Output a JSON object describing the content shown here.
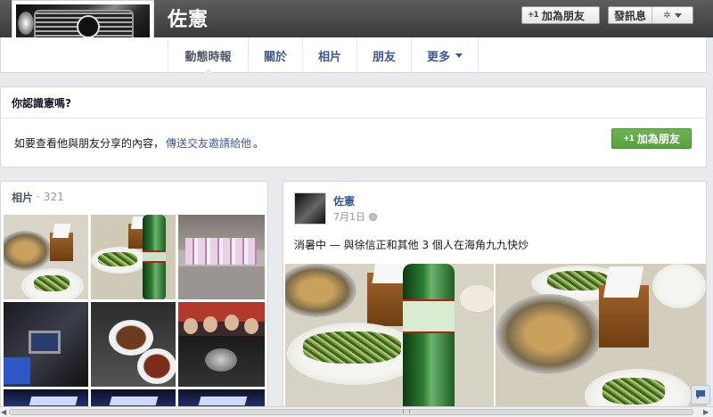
{
  "profile": {
    "name": "佐憲"
  },
  "header_actions": {
    "add_friend_label": "加為朋友",
    "add_friend_glyph": "+1",
    "message_label": "發訊息",
    "settings_glyph": "✲"
  },
  "tabs": [
    {
      "label": "動態時報",
      "active": true
    },
    {
      "label": "關於",
      "active": false
    },
    {
      "label": "相片",
      "active": false
    },
    {
      "label": "朋友",
      "active": false
    },
    {
      "label": "更多",
      "active": false
    }
  ],
  "know_box": {
    "title": "你認識憲嗎?",
    "body_prefix": "如要查看他與朋友分享的內容，",
    "body_link": "傳送交友邀請給他",
    "body_suffix": "。",
    "button_label": "加為朋友",
    "button_glyph": "+1"
  },
  "photos_panel": {
    "title": "相片",
    "separator": "·",
    "count": "321"
  },
  "post": {
    "author": "佐憲",
    "date": "7月1日",
    "text_prefix": "消暑中 — 與",
    "tagged": "徐信正",
    "text_mid": "和",
    "others": "其他 3 個人",
    "text_at": "在",
    "place": "海角九九快炒"
  },
  "colors": {
    "link": "#3b5998",
    "green_button": "#5aa341",
    "page_bg": "#e9eaed"
  },
  "icons": {
    "privacy": "globe-icon",
    "chat": "chat-icon",
    "more_caret": "chevron-down-icon"
  }
}
